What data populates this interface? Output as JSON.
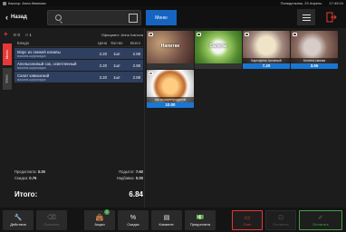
{
  "status": {
    "cashier": "Кассир: Анна Иванова",
    "date": "Понедельник, 29 Апрель",
    "time": "17:49:24"
  },
  "toolbar": {
    "back_label": "Назад",
    "menu_tab": "Меню"
  },
  "left_tabs": [
    {
      "label": "Меню"
    },
    {
      "label": "Заказ"
    }
  ],
  "order": {
    "guests": "0",
    "seat": "1",
    "waiter": "Официант: Анна Ivanova"
  },
  "table": {
    "headers": {
      "name": "Блюдо",
      "price": "Цена",
      "qty": "Кол-во",
      "sum": "Всего"
    },
    "rows": [
      {
        "name": "Морс из свежей клюквы",
        "sub": "машина-шукрасадка",
        "price": "3.20",
        "qty": "1шт",
        "sum": "2.88"
      },
      {
        "name": "Апельсиновый сок, осветленный",
        "sub": "машина-шукрасадка",
        "price": "3.20",
        "qty": "1шт",
        "sum": "2.88"
      },
      {
        "name": "Салат кавказский",
        "sub": "машина-шукрасадка",
        "price": "3.20",
        "qty": "1шт",
        "sum": "2.88"
      }
    ]
  },
  "totals": {
    "prepay_label": "Предоплата:",
    "prepay": "0.00",
    "subtotal_label": "Подытог:",
    "subtotal": "7.60",
    "discount_label": "Скидка:",
    "discount": "0.76",
    "surcharge_label": "Надбавка:",
    "surcharge": "0.00",
    "grand_label": "Итого:",
    "grand": "6.84"
  },
  "menu_tiles": [
    {
      "title": "Напитки",
      "caption": "",
      "price": "",
      "color": "#6d4c41"
    },
    {
      "title": "Салаты",
      "caption": "",
      "price": "",
      "color": "#7cb342"
    },
    {
      "title": "",
      "caption": "Картофель толченый",
      "price": "7.20",
      "color": "#a1887f"
    },
    {
      "title": "",
      "caption": "Котлета свиная",
      "price": "3.55",
      "color": "#8d6e63"
    },
    {
      "title": "",
      "caption": "суп из морепродуктов",
      "price": "10.00",
      "color": "#bf6b2e"
    }
  ],
  "bottom": {
    "actions": "Действия",
    "clear": "Очистить",
    "promos": "Акции",
    "promos_count": "1",
    "discount": "Скидка",
    "comment": "Коммент.",
    "prepay": "Предоплата",
    "check": "Счет",
    "pay_disabled": "Оплатить",
    "pay": "Оплатить"
  },
  "colors": {
    "accent_blue": "#1565c0",
    "red": "#e53935",
    "green": "#43a047"
  }
}
